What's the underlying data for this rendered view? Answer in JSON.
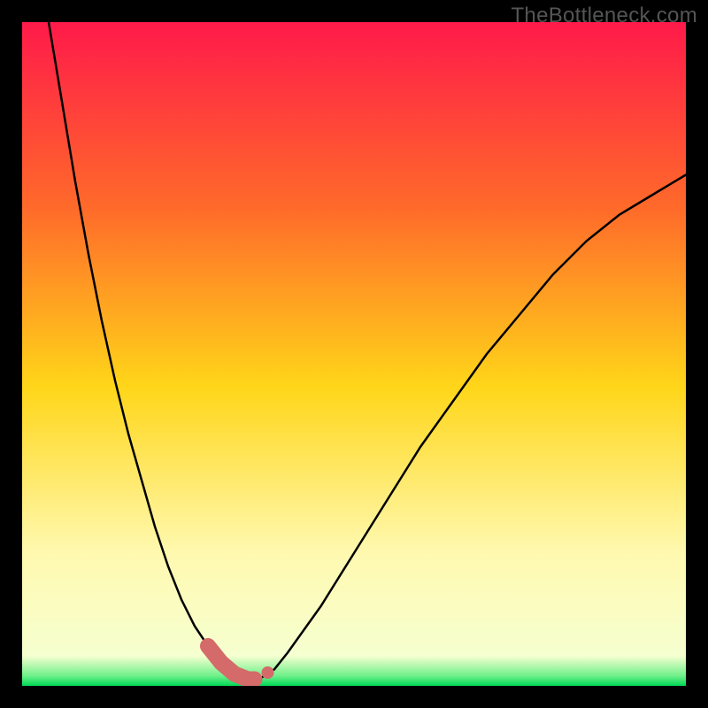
{
  "watermark": "TheBottleneck.com",
  "colors": {
    "page_bg": "#000000",
    "gradient_top": "#ff1a4a",
    "gradient_mid_top": "#ff6a2a",
    "gradient_mid": "#ffd619",
    "gradient_low": "#fff9b0",
    "gradient_bottom": "#00e35b",
    "curve": "#000000",
    "marker": "#d46a6a"
  },
  "chart_data": {
    "type": "line",
    "title": "",
    "xlabel": "",
    "ylabel": "",
    "xlim": [
      0,
      100
    ],
    "ylim": [
      0,
      100
    ],
    "grid": false,
    "legend": false,
    "series": [
      {
        "name": "bottleneck-curve",
        "x": [
          4,
          6,
          8,
          10,
          12,
          14,
          16,
          18,
          20,
          22,
          24,
          26,
          28,
          30,
          32,
          34,
          35,
          36,
          38,
          40,
          45,
          50,
          55,
          60,
          65,
          70,
          75,
          80,
          85,
          90,
          95,
          100
        ],
        "y": [
          100,
          88,
          76,
          65,
          55,
          46,
          38,
          31,
          24,
          18,
          13,
          9,
          6,
          3.5,
          1.8,
          1,
          1,
          1.2,
          2.5,
          5,
          12,
          20,
          28,
          36,
          43,
          50,
          56,
          62,
          67,
          71,
          74,
          77
        ]
      }
    ],
    "markers": [
      {
        "name": "highlight-segment",
        "x_range": [
          28,
          35
        ],
        "y": 1,
        "style": "thick"
      },
      {
        "name": "highlight-dot",
        "x": 37,
        "y": 2
      }
    ],
    "background_heatmap": {
      "orientation": "vertical",
      "stops": [
        {
          "pos": 0.0,
          "color": "#ff1a4a"
        },
        {
          "pos": 0.28,
          "color": "#ff6a2a"
        },
        {
          "pos": 0.55,
          "color": "#ffd619"
        },
        {
          "pos": 0.8,
          "color": "#fff9b0"
        },
        {
          "pos": 0.955,
          "color": "#f6ffd0"
        },
        {
          "pos": 0.985,
          "color": "#6ef08a"
        },
        {
          "pos": 1.0,
          "color": "#00d856"
        }
      ]
    }
  }
}
